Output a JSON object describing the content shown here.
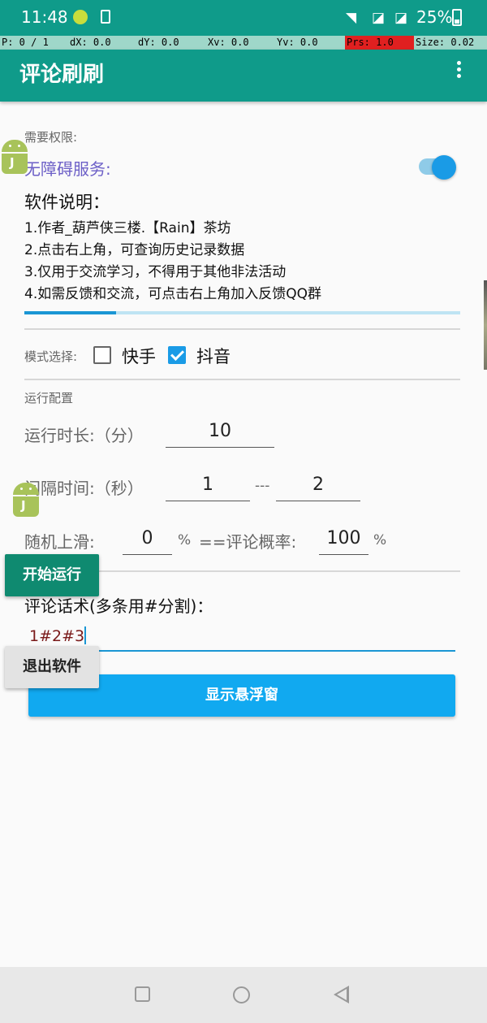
{
  "status_bar": {
    "time": "11:48",
    "battery": "25%"
  },
  "pointer_location": {
    "p": "P: 0 / 1",
    "dx": "dX: 0.0",
    "dy": "dY: 0.0",
    "xv": "Xv: 0.0",
    "yv": "Yv: 0.0",
    "prs": "Prs: 1.0",
    "size": "Size: 0.02",
    "highlight_color": "#e02020"
  },
  "app_bar": {
    "title": "评论刷刷",
    "menu_icon": "more-vert-icon"
  },
  "permissions": {
    "label": "需要权限:",
    "accessibility_label": "无障碍服务:",
    "accessibility_enabled": true
  },
  "description": {
    "title": "软件说明：",
    "lines": [
      "1.作者_葫芦侠三楼.【Rain】茶坊",
      "2.点击右上角，可查询历史记录数据",
      "3.仅用于交流学习，不得用于其他非法活动",
      "4.如需反馈和交流，可点击右上角加入反馈QQ群"
    ],
    "progress_fraction": 0.21
  },
  "mode": {
    "label": "模式选择:",
    "options": [
      {
        "label": "快手",
        "checked": false
      },
      {
        "label": "抖音",
        "checked": true
      }
    ]
  },
  "run_config": {
    "section_label": "运行配置",
    "duration_label": "运行时长:（分）",
    "duration_value": "10",
    "interval_label": "间隔时间:（秒）",
    "interval_min": "1",
    "interval_sep": "---",
    "interval_max": "2",
    "swipe_label": "随机上滑:",
    "swipe_value": "0",
    "swipe_unit": "%",
    "comment_prob_label": "==评论概率:",
    "comment_prob_value": "100",
    "comment_prob_unit": "%"
  },
  "phrases": {
    "label": "评论话术(多条用#分割)：",
    "value": "1#2#3"
  },
  "buttons": {
    "show_float": "显示悬浮窗",
    "start": "开始运行",
    "exit": "退出软件"
  },
  "colors": {
    "primary": "#0f9b8a",
    "accent": "#1a9be6",
    "float_button": "#11a9f0",
    "start_button": "#0f8a70",
    "a11y_label": "#6c5fc7"
  }
}
